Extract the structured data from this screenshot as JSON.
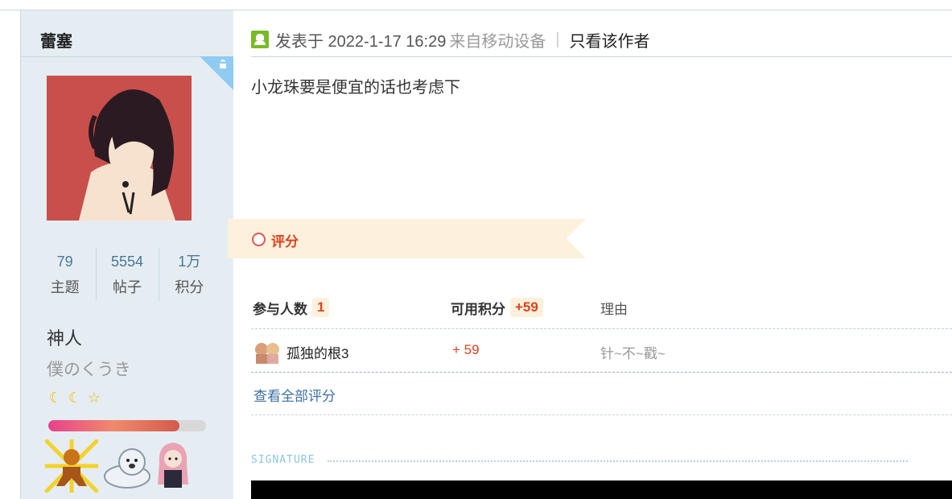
{
  "sidebar": {
    "username": "蕾塞",
    "stats": [
      {
        "value": "79",
        "label": "主题"
      },
      {
        "value": "5554",
        "label": "帖子"
      },
      {
        "value": "1万",
        "label": "积分"
      }
    ],
    "rank": "神人",
    "custom_title": "僕のくうき",
    "level_progress": 0.83
  },
  "post": {
    "time_label": "发表于 2022-1-17 16:29",
    "device_label": "来自移动设备",
    "separator": "|",
    "only_author_label": "只看该作者",
    "body": "小龙珠要是便宜的话也考虑下"
  },
  "rating": {
    "title": "评分",
    "participants_label": "参与人数",
    "participants_count": "1",
    "points_label": "可用积分",
    "points_total": "+59",
    "reason_label": "理由",
    "rows": [
      {
        "name": "孤独的根3",
        "score": "+ 59",
        "reason": "针~不~戳~"
      }
    ],
    "view_all": "查看全部评分"
  },
  "signature": {
    "label": "SIGNATURE"
  }
}
